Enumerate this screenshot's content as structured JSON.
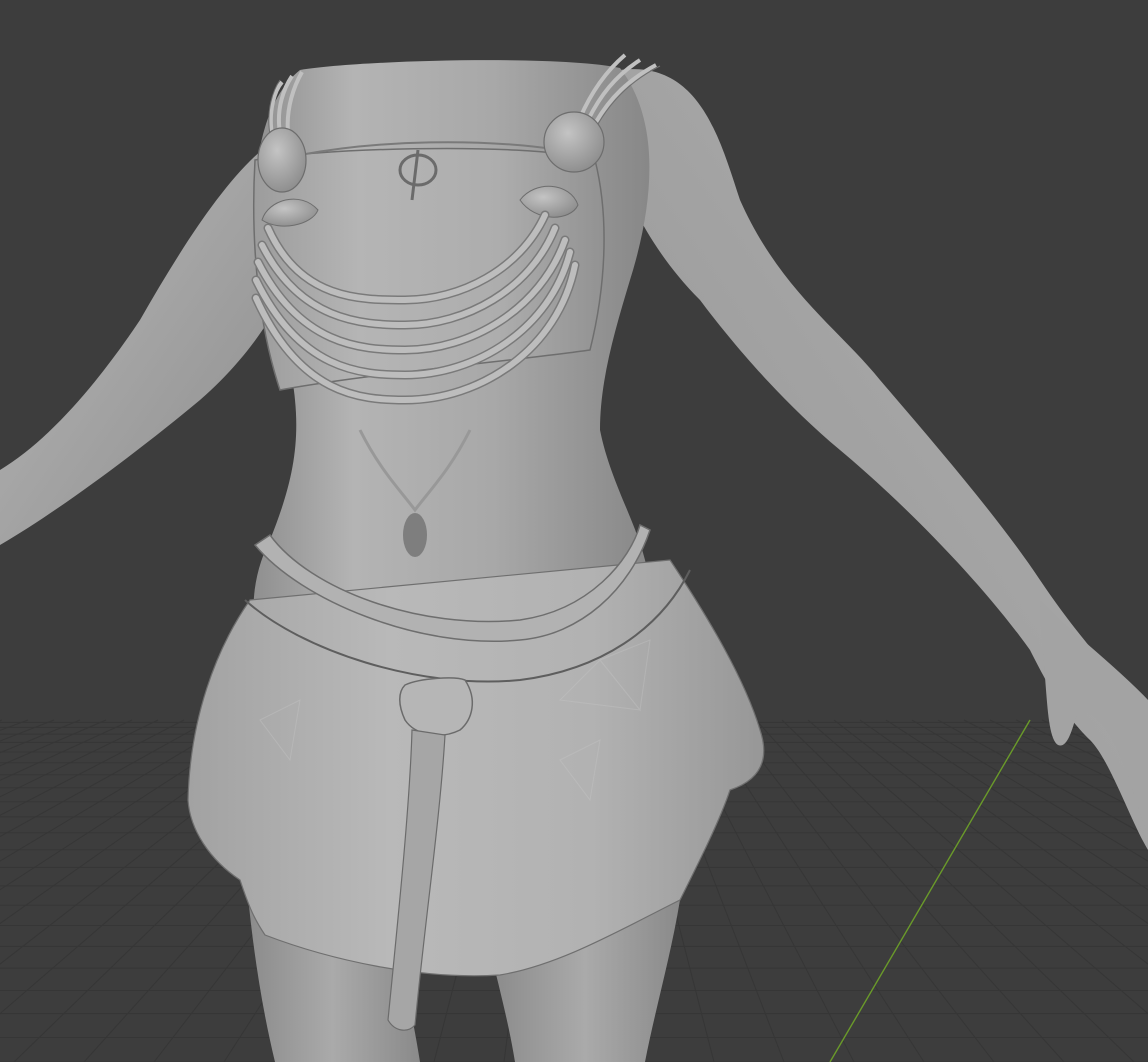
{
  "viewport": {
    "editor": "3D Viewport",
    "shading_mode": "solid",
    "background_color": "#3d3d3d",
    "grid_line_color": "#363636",
    "y_axis_color": "#6a9a2a",
    "overlays": {
      "floor_grid": true,
      "y_axis_line": true
    }
  },
  "model": {
    "material_color": "#a9a9a9",
    "parts": [
      "torso",
      "left-arm",
      "right-arm",
      "left-hand",
      "breast-cloth",
      "shoulder-straps",
      "shoulder-beads",
      "bead-necklace",
      "chest-emblem",
      "waist-belt",
      "belt-knot",
      "hanging-tie",
      "skirt",
      "legs"
    ]
  }
}
